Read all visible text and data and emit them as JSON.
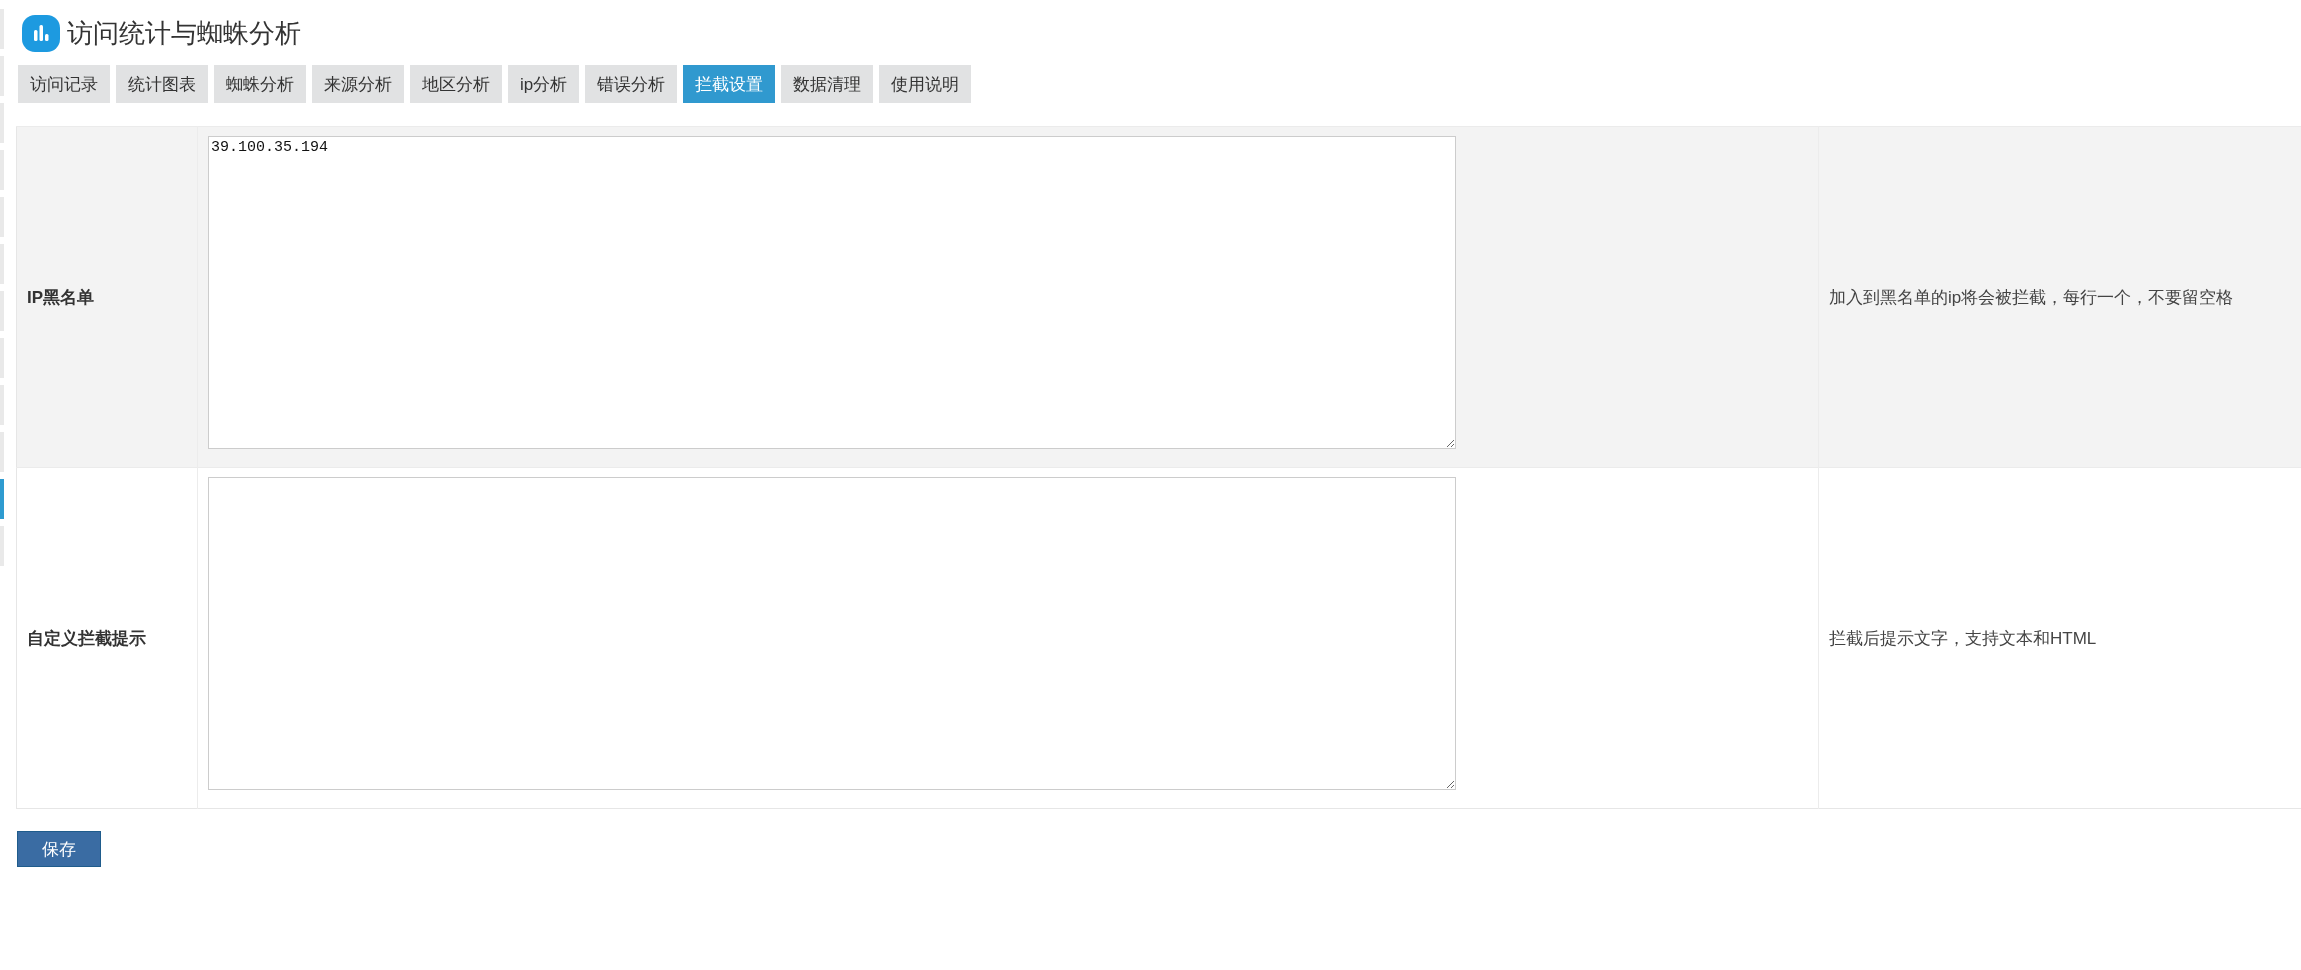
{
  "sidebar": {
    "items": [
      {
        "selected": false
      },
      {
        "selected": false
      },
      {
        "selected": false
      },
      {
        "selected": false
      },
      {
        "selected": false
      },
      {
        "selected": false
      },
      {
        "selected": false
      },
      {
        "selected": false
      },
      {
        "selected": false
      },
      {
        "selected": false
      },
      {
        "selected": true
      },
      {
        "selected": false
      }
    ]
  },
  "header": {
    "title": "访问统计与蜘蛛分析"
  },
  "tabs": [
    {
      "label": "访问记录",
      "selected": false
    },
    {
      "label": "统计图表",
      "selected": false
    },
    {
      "label": "蜘蛛分析",
      "selected": false
    },
    {
      "label": "来源分析",
      "selected": false
    },
    {
      "label": "地区分析",
      "selected": false
    },
    {
      "label": "ip分析",
      "selected": false
    },
    {
      "label": "错误分析",
      "selected": false
    },
    {
      "label": "拦截设置",
      "selected": true
    },
    {
      "label": "数据清理",
      "selected": false
    },
    {
      "label": "使用说明",
      "selected": false
    }
  ],
  "settings": {
    "rows": [
      {
        "label": "IP黑名单",
        "value": "39.100.35.194",
        "hint": "加入到黑名单的ip将会被拦截，每行一个，不要留空格"
      },
      {
        "label": "自定义拦截提示",
        "hint": "拦截后提示文字，支持文本和HTML"
      }
    ]
  },
  "save_button": {
    "label": "保存"
  }
}
